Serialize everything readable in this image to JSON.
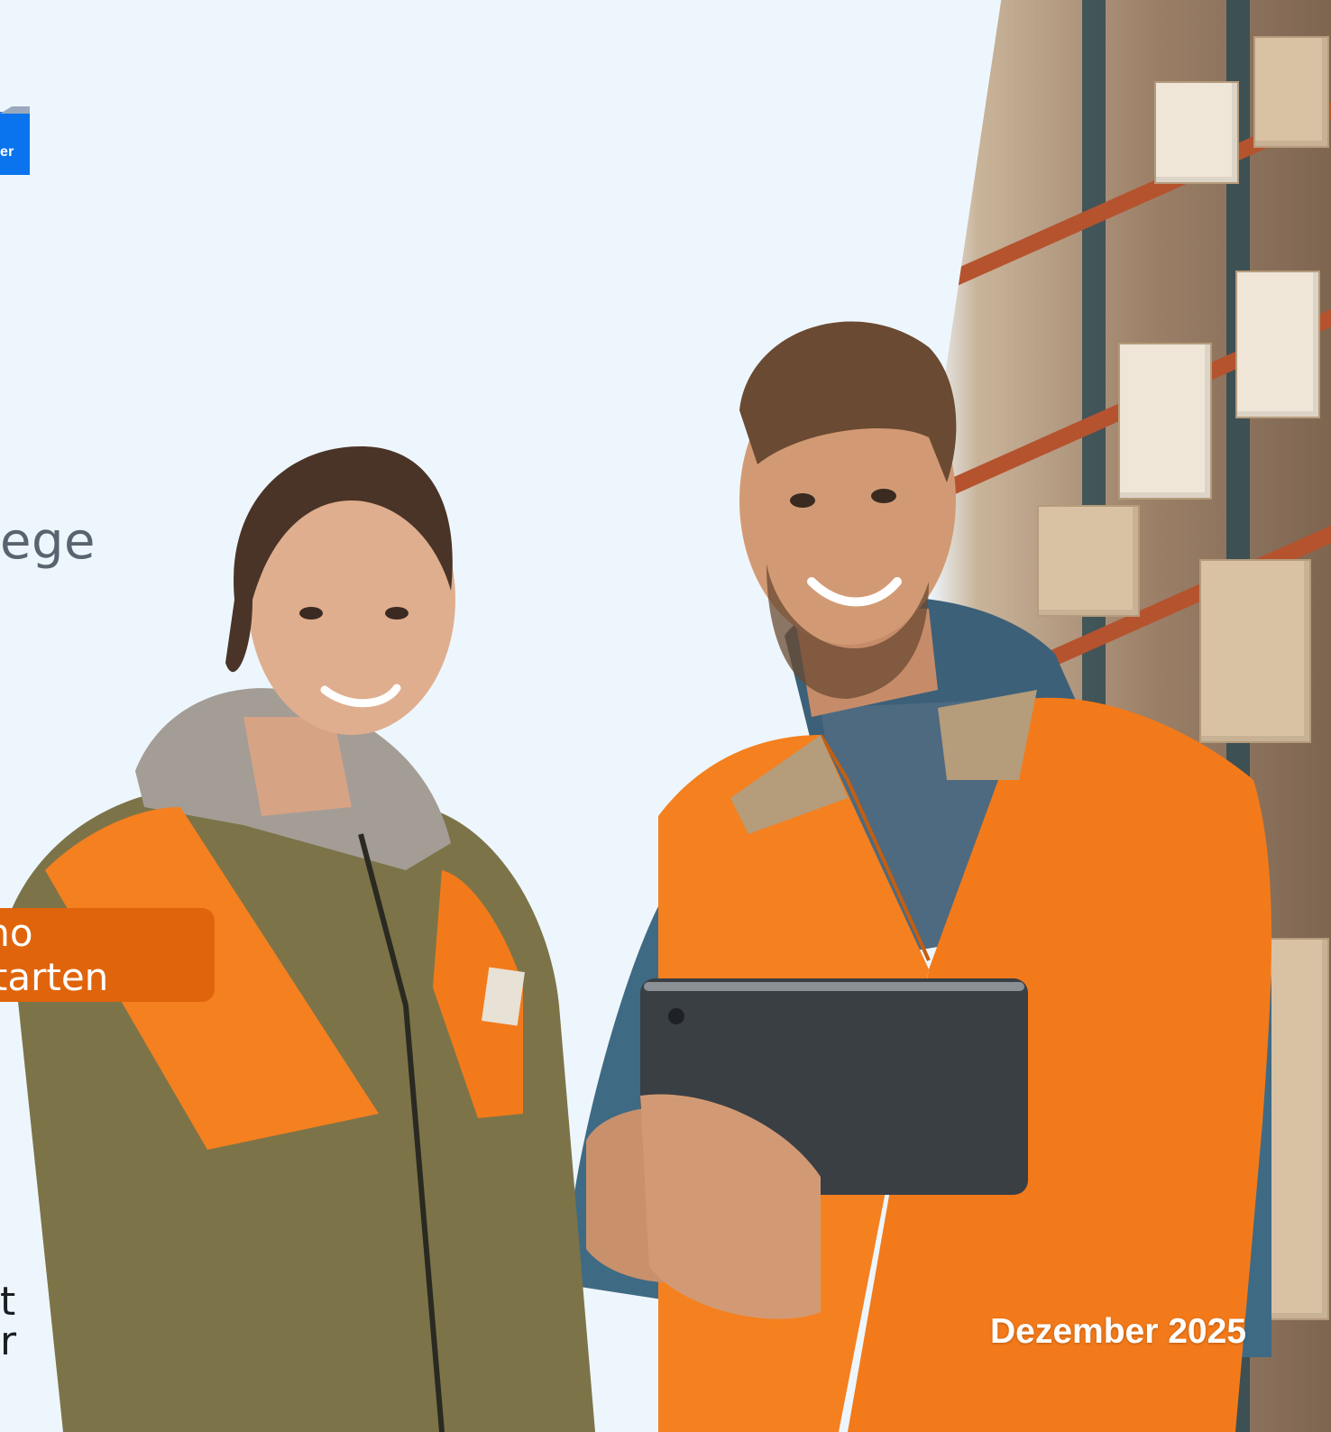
{
  "logo": {
    "text_fragment": "er",
    "color": "#0a74ee"
  },
  "hero": {
    "headline_fragment": "ege"
  },
  "cta": {
    "label": "mo starten",
    "color": "#e0640c"
  },
  "footer": {
    "fragment_line1": "t",
    "fragment_line2": "r"
  },
  "date": {
    "label": "Dezember 2025"
  },
  "image": {
    "subject": "two-warehouse-workers-with-tablet",
    "icon": "warehouse-photo"
  }
}
